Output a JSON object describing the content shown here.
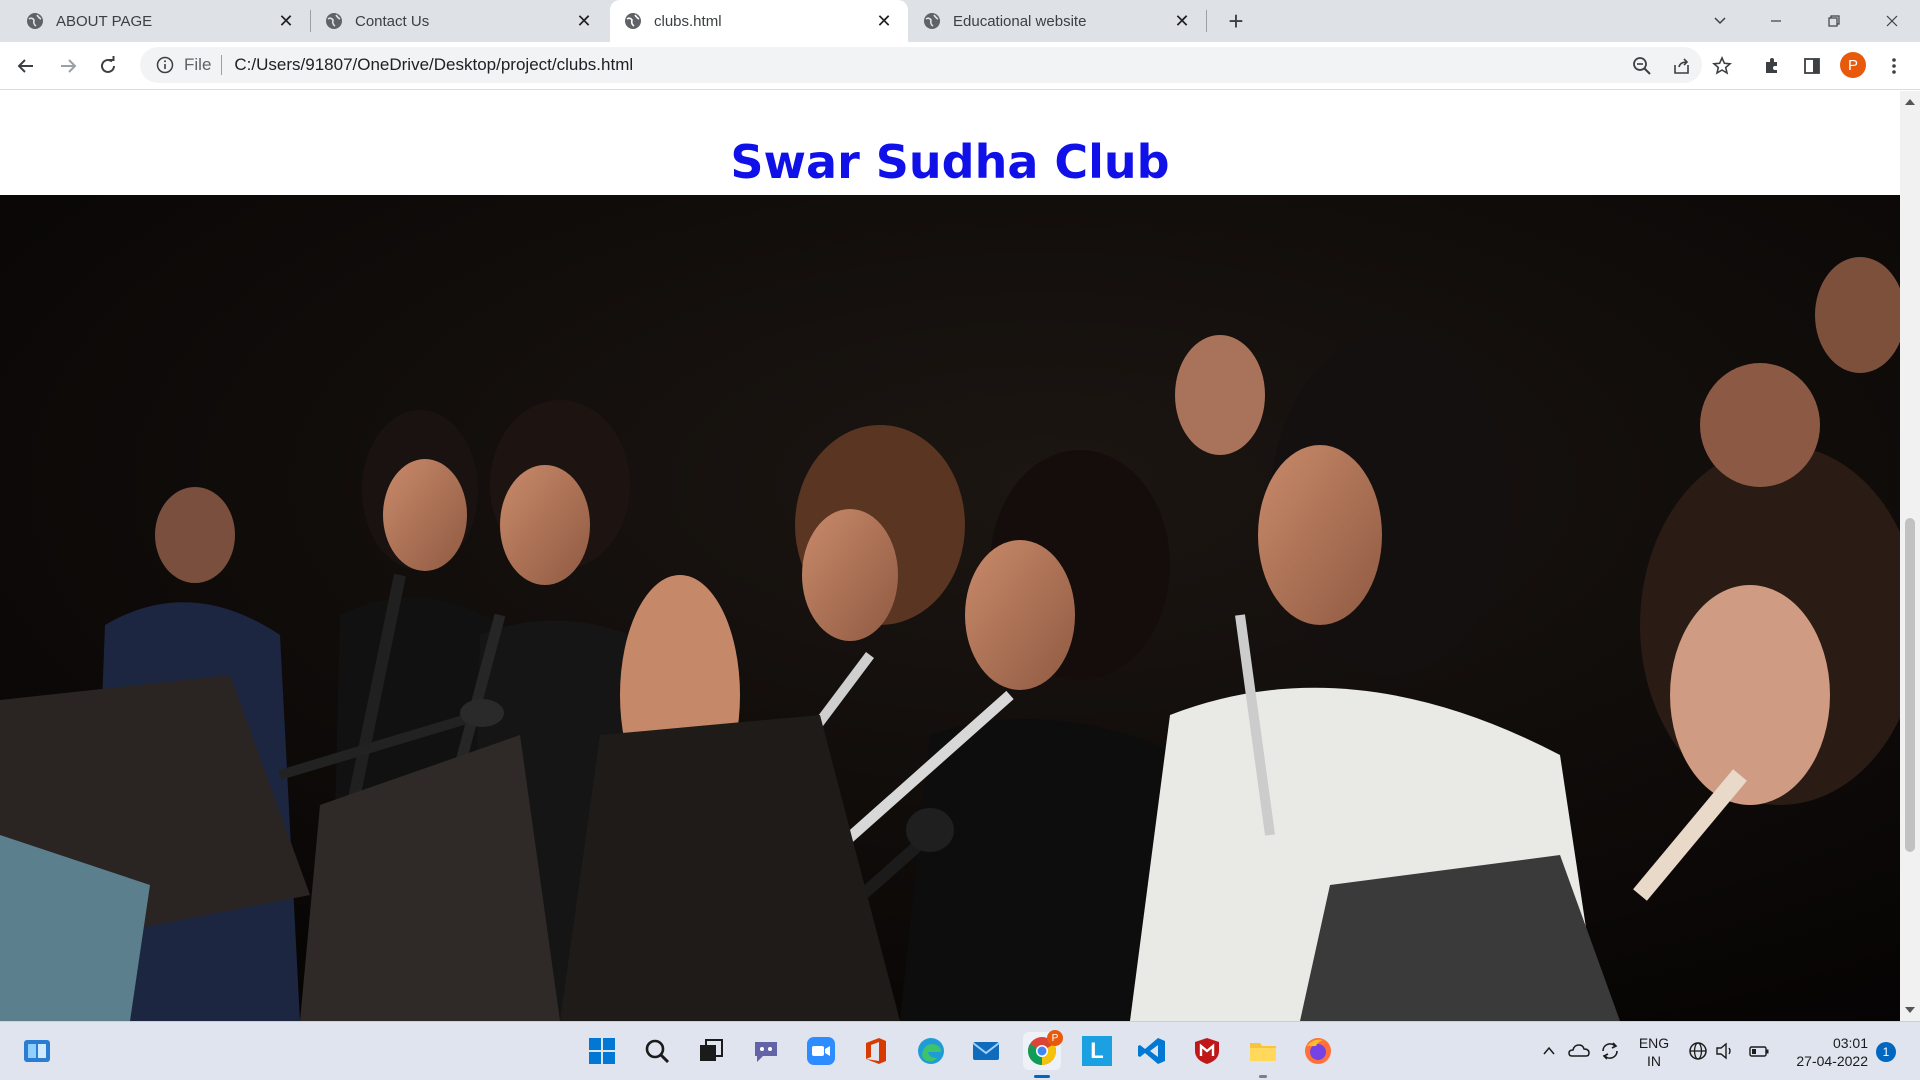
{
  "browser": {
    "tabs": [
      {
        "label": "ABOUT PAGE",
        "active": false
      },
      {
        "label": "Contact Us",
        "active": false
      },
      {
        "label": "clubs.html",
        "active": true
      },
      {
        "label": "Educational website",
        "active": false
      }
    ],
    "new_tab_symbol": "+",
    "tab_close_symbol": "✕",
    "omnibox": {
      "scheme_label": "File",
      "url": "C:/Users/91807/OneDrive/Desktop/project/clubs.html"
    },
    "profile_initial": "P",
    "icons": [
      "back-icon",
      "forward-icon",
      "reload-icon",
      "info-icon",
      "zoom-icon",
      "share-icon",
      "bookmark-star-icon",
      "extensions-icon",
      "side-panel-icon",
      "menu-icon"
    ]
  },
  "page": {
    "title": "Swar Sudha Club",
    "hero_image": "photo of a school band: girls playing flutes and clarinets at music stands with microphones, dark stage background"
  },
  "taskbar": {
    "pinned_apps": [
      "windows-start-icon",
      "search-icon",
      "task-view-icon",
      "teams-chat-icon",
      "zoom-icon",
      "office-icon",
      "edge-icon",
      "mail-icon",
      "chrome-icon",
      "app-l-icon",
      "vscode-icon",
      "mcafee-icon",
      "file-explorer-icon",
      "firefox-icon"
    ],
    "chrome_badge": "P",
    "app_l_letter": "L",
    "tray": {
      "language_line1": "ENG",
      "language_line2": "IN",
      "time": "03:01",
      "date": "27-04-2022",
      "notification_count": "1"
    }
  },
  "colors": {
    "title_blue": "#1010e8",
    "tabstrip_bg": "#dee1e6",
    "taskbar_bg": "#dfe4ee",
    "accent": "#0067c0"
  }
}
